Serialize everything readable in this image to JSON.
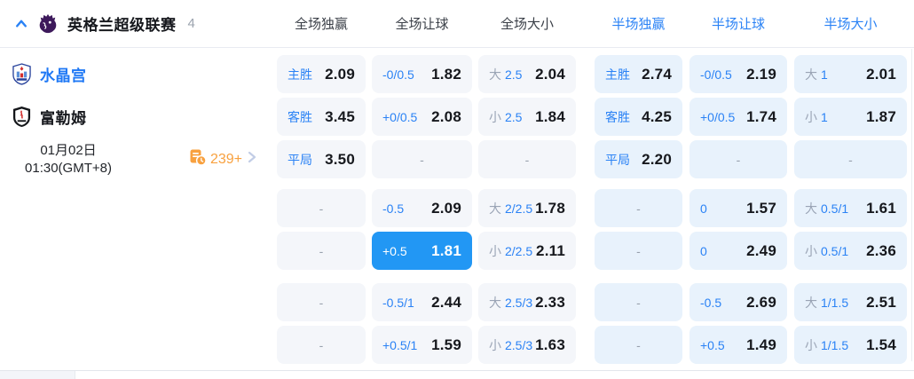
{
  "colors": {
    "accent_blue": "#2a82f5",
    "selected_blue": "#2297f4",
    "full_cell_bg": "#f4f6fa",
    "half_cell_bg": "#e8f2fc",
    "orange": "#f8a13f",
    "value_dark": "#16181d",
    "gray_label": "#9aa4b5"
  },
  "header": {
    "league_name": "英格兰超级联赛",
    "match_count": "4",
    "columns": [
      {
        "label": "全场独赢",
        "market": "full"
      },
      {
        "label": "全场让球",
        "market": "full"
      },
      {
        "label": "全场大小",
        "market": "full"
      },
      {
        "label": "半场独赢",
        "market": "half"
      },
      {
        "label": "半场让球",
        "market": "half"
      },
      {
        "label": "半场大小",
        "market": "half"
      }
    ]
  },
  "match": {
    "home_team": "水晶宫",
    "away_team": "富勒姆",
    "date": "01月02日",
    "time": "01:30(GMT+8)",
    "more_markets_count": "239+"
  },
  "odds_rows": [
    {
      "cells": [
        {
          "gray_label": "",
          "blue_label": "主胜",
          "value": "2.09",
          "market": "full"
        },
        {
          "gray_label": "",
          "blue_label": "-0/0.5",
          "value": "1.82",
          "market": "full"
        },
        {
          "gray_label": "大",
          "blue_label": "2.5",
          "value": "2.04",
          "market": "full"
        },
        {
          "gray_label": "",
          "blue_label": "主胜",
          "value": "2.74",
          "market": "half"
        },
        {
          "gray_label": "",
          "blue_label": "-0/0.5",
          "value": "2.19",
          "market": "half"
        },
        {
          "gray_label": "大",
          "blue_label": "1",
          "value": "2.01",
          "market": "half"
        }
      ]
    },
    {
      "cells": [
        {
          "gray_label": "",
          "blue_label": "客胜",
          "value": "3.45",
          "market": "full"
        },
        {
          "gray_label": "",
          "blue_label": "+0/0.5",
          "value": "2.08",
          "market": "full"
        },
        {
          "gray_label": "小",
          "blue_label": "2.5",
          "value": "1.84",
          "market": "full"
        },
        {
          "gray_label": "",
          "blue_label": "客胜",
          "value": "4.25",
          "market": "half"
        },
        {
          "gray_label": "",
          "blue_label": "+0/0.5",
          "value": "1.74",
          "market": "half"
        },
        {
          "gray_label": "小",
          "blue_label": "1",
          "value": "1.87",
          "market": "half"
        }
      ]
    },
    {
      "cells": [
        {
          "gray_label": "",
          "blue_label": "平局",
          "value": "3.50",
          "market": "full"
        },
        {
          "gray_label": "",
          "blue_label": "",
          "value": "-",
          "market": "full"
        },
        {
          "gray_label": "",
          "blue_label": "",
          "value": "-",
          "market": "full"
        },
        {
          "gray_label": "",
          "blue_label": "平局",
          "value": "2.20",
          "market": "half"
        },
        {
          "gray_label": "",
          "blue_label": "",
          "value": "-",
          "market": "half"
        },
        {
          "gray_label": "",
          "blue_label": "",
          "value": "-",
          "market": "half"
        }
      ]
    },
    {
      "cells": [
        {
          "gray_label": "",
          "blue_label": "",
          "value": "-",
          "market": "full"
        },
        {
          "gray_label": "",
          "blue_label": "-0.5",
          "value": "2.09",
          "market": "full"
        },
        {
          "gray_label": "大",
          "blue_label": "2/2.5",
          "value": "1.78",
          "market": "full"
        },
        {
          "gray_label": "",
          "blue_label": "",
          "value": "-",
          "market": "half"
        },
        {
          "gray_label": "",
          "blue_label": "0",
          "value": "1.57",
          "market": "half"
        },
        {
          "gray_label": "大",
          "blue_label": "0.5/1",
          "value": "1.61",
          "market": "half"
        }
      ]
    },
    {
      "cells": [
        {
          "gray_label": "",
          "blue_label": "",
          "value": "-",
          "market": "full"
        },
        {
          "gray_label": "",
          "blue_label": "+0.5",
          "value": "1.81",
          "market": "full",
          "selected": true
        },
        {
          "gray_label": "小",
          "blue_label": "2/2.5",
          "value": "2.11",
          "market": "full"
        },
        {
          "gray_label": "",
          "blue_label": "",
          "value": "-",
          "market": "half"
        },
        {
          "gray_label": "",
          "blue_label": "0",
          "value": "2.49",
          "market": "half"
        },
        {
          "gray_label": "小",
          "blue_label": "0.5/1",
          "value": "2.36",
          "market": "half"
        }
      ]
    },
    {
      "cells": [
        {
          "gray_label": "",
          "blue_label": "",
          "value": "-",
          "market": "full"
        },
        {
          "gray_label": "",
          "blue_label": "-0.5/1",
          "value": "2.44",
          "market": "full"
        },
        {
          "gray_label": "大",
          "blue_label": "2.5/3",
          "value": "2.33",
          "market": "full"
        },
        {
          "gray_label": "",
          "blue_label": "",
          "value": "-",
          "market": "half"
        },
        {
          "gray_label": "",
          "blue_label": "-0.5",
          "value": "2.69",
          "market": "half"
        },
        {
          "gray_label": "大",
          "blue_label": "1/1.5",
          "value": "2.51",
          "market": "half"
        }
      ]
    },
    {
      "cells": [
        {
          "gray_label": "",
          "blue_label": "",
          "value": "-",
          "market": "full"
        },
        {
          "gray_label": "",
          "blue_label": "+0.5/1",
          "value": "1.59",
          "market": "full"
        },
        {
          "gray_label": "小",
          "blue_label": "2.5/3",
          "value": "1.63",
          "market": "full"
        },
        {
          "gray_label": "",
          "blue_label": "",
          "value": "-",
          "market": "half"
        },
        {
          "gray_label": "",
          "blue_label": "+0.5",
          "value": "1.49",
          "market": "half"
        },
        {
          "gray_label": "小",
          "blue_label": "1/1.5",
          "value": "1.54",
          "market": "half"
        }
      ]
    }
  ]
}
